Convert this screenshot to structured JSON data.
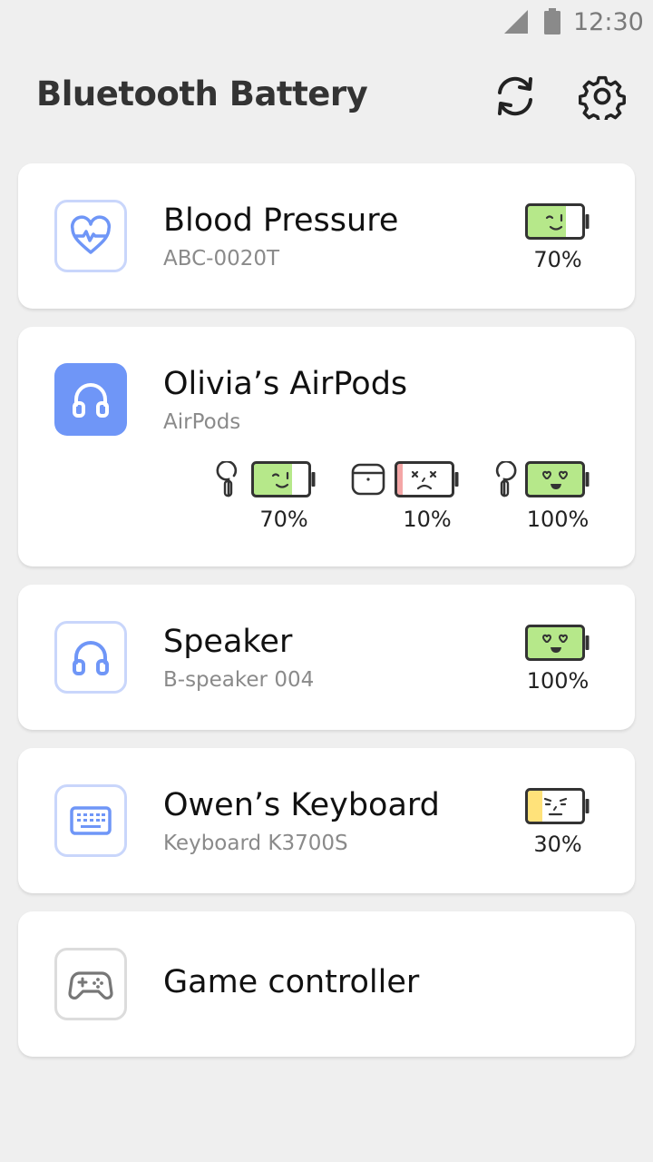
{
  "status_bar": {
    "time": "12:30"
  },
  "app_bar": {
    "title": "Bluetooth Battery",
    "refresh_icon": "refresh-icon",
    "settings_icon": "gear-icon"
  },
  "colors": {
    "accent": "#6f96f7",
    "battery_good": "#b6e88a",
    "battery_low": "#f4a6a6",
    "battery_mid": "#ffe27a"
  },
  "devices": [
    {
      "name": "Blood Pressure",
      "model": "ABC-0020T",
      "icon": "heart-pulse-icon",
      "battery": {
        "level": 70,
        "label": "70%"
      }
    },
    {
      "name": "Olivia’s AirPods",
      "model": "AirPods",
      "icon": "headphones-icon",
      "components": [
        {
          "part": "left-earbud",
          "level": 70,
          "label": "70%"
        },
        {
          "part": "case",
          "level": 10,
          "label": "10%"
        },
        {
          "part": "right-earbud",
          "level": 100,
          "label": "100%"
        }
      ]
    },
    {
      "name": "Speaker",
      "model": "B-speaker 004",
      "icon": "headphones-icon",
      "battery": {
        "level": 100,
        "label": "100%"
      }
    },
    {
      "name": "Owen’s Keyboard",
      "model": "Keyboard K3700S",
      "icon": "keyboard-icon",
      "battery": {
        "level": 30,
        "label": "30%"
      }
    },
    {
      "name": "Game controller",
      "icon": "gamepad-icon"
    }
  ]
}
